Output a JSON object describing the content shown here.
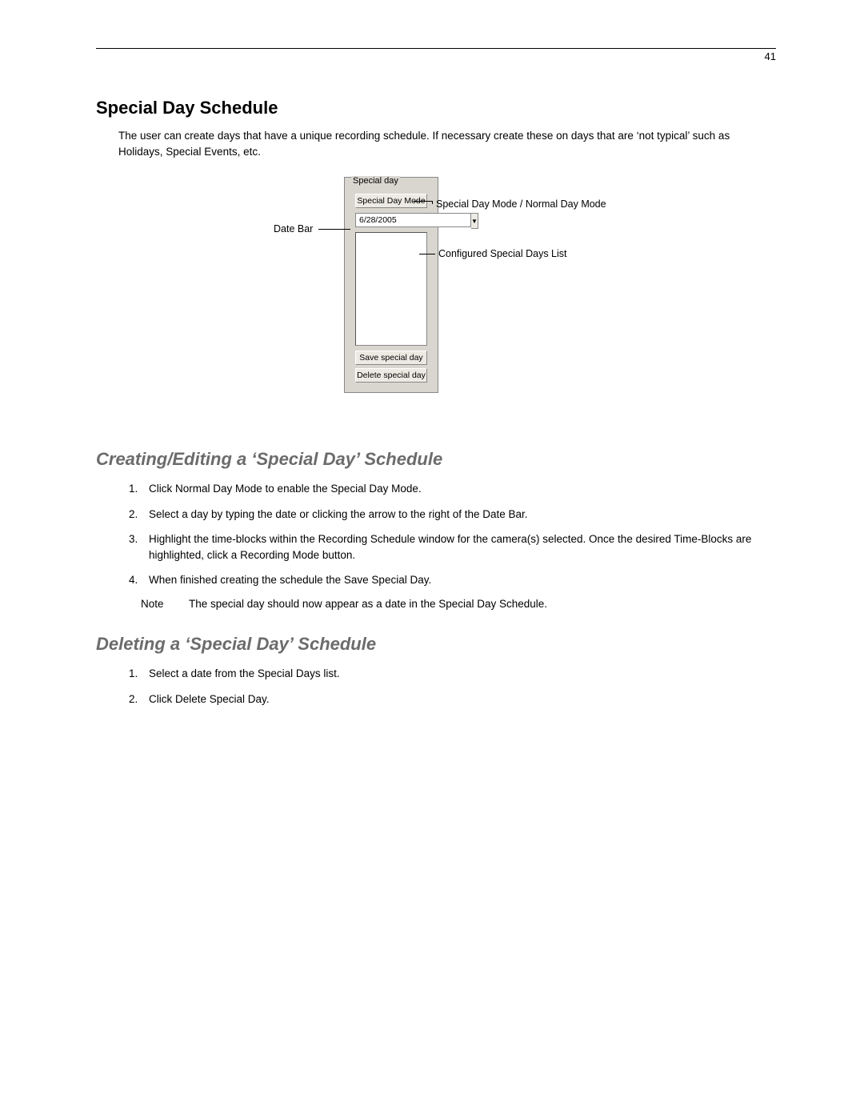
{
  "page_number": "41",
  "h1": "Special Day Schedule",
  "intro": "The user can create days that have a unique recording schedule. If necessary create these on days that are ‘not typical’ such as Holidays, Special Events, etc.",
  "panel": {
    "title": "Special day",
    "mode_btn": "Special Day Mode",
    "date_value": "6/28/2005",
    "save_btn": "Save special day",
    "delete_btn": "Delete special day"
  },
  "callouts": {
    "mode": "Special Day Mode / Normal Day Mode",
    "date": "Date Bar",
    "list": "Configured Special Days List"
  },
  "h2a": "Creating/Editing a ‘Special Day’ Schedule",
  "steps_a": {
    "s1a": "Click ",
    "s1b": "Normal Day Mode",
    "s1c": " to enable the ",
    "s1d": "Special Day Mode",
    "s1e": ".",
    "s2": "Select a day by typing the date or clicking the arrow to the right of the Date Bar.",
    "s3a": "Highlight the time-blocks within the ",
    "s3b": "Recording Schedule",
    "s3c": " window for the camera(s) selected. Once the desired Time-Blocks are highlighted, click a Recording Mode button.",
    "s4a": "When finished creating the schedule ",
    "s4b": "the Save Special Day",
    "s4c": "."
  },
  "note_label": "Note",
  "note_text": "The special day should now appear as a date in the Special Day Schedule.",
  "h2b": "Deleting a ‘Special Day’ Schedule",
  "steps_b": {
    "s1": "Select a date from the Special Days list.",
    "s2a": "Click ",
    "s2b": "Delete Special Day",
    "s2c": "."
  }
}
